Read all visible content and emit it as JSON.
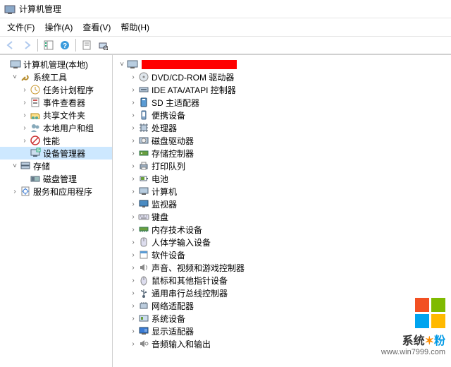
{
  "title": "计算机管理",
  "menu": {
    "file": "文件(F)",
    "action": "操作(A)",
    "view": "查看(V)",
    "help": "帮助(H)"
  },
  "left": {
    "root": "计算机管理(本地)",
    "systools": "系统工具",
    "task": "任务计划程序",
    "event": "事件查看器",
    "shared": "共享文件夹",
    "users": "本地用户和组",
    "perf": "性能",
    "devmgr": "设备管理器",
    "storage": "存储",
    "disk": "磁盘管理",
    "services": "服务和应用程序"
  },
  "right": {
    "items": [
      "DVD/CD-ROM 驱动器",
      "IDE ATA/ATAPI 控制器",
      "SD 主适配器",
      "便携设备",
      "处理器",
      "磁盘驱动器",
      "存储控制器",
      "打印队列",
      "电池",
      "计算机",
      "监视器",
      "键盘",
      "内存技术设备",
      "人体学输入设备",
      "软件设备",
      "声音、视频和游戏控制器",
      "鼠标和其他指针设备",
      "通用串行总线控制器",
      "网络适配器",
      "系统设备",
      "显示适配器",
      "音频输入和输出"
    ]
  },
  "watermark": {
    "brand_a": "系统",
    "brand_b": "粉",
    "url": "www.win7999.com"
  }
}
